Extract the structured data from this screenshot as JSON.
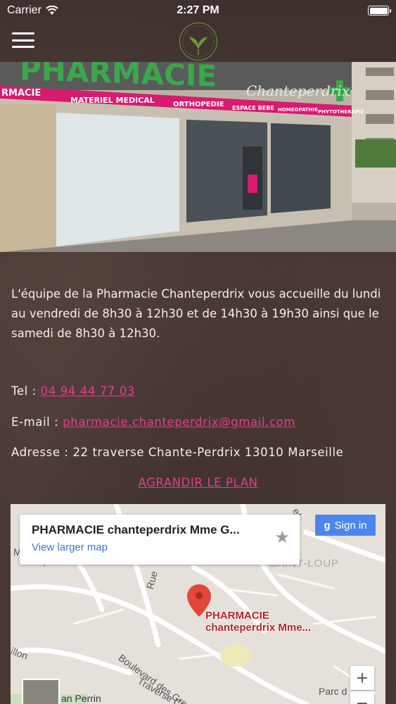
{
  "status_bar": {
    "carrier": "Carrier",
    "time": "2:27 PM"
  },
  "header": {
    "logo_text": "PHARMACIE Chanteperdrix"
  },
  "hero": {
    "sign_main": "PHARMACIE",
    "sign_script": "Chanteperdrix",
    "banner_items": [
      "RMACIE",
      "MATERIEL MEDICAL",
      "ORTHOPEDIE",
      "ESPACE BEBE",
      "HOMEOPATHIE",
      "PHYTOTHERAPIE"
    ],
    "brand_green": "#3aa84b",
    "brand_pink": "#d81b6e"
  },
  "intro": {
    "text": "L'équipe de la Pharmacie Chanteperdrix vous accueille du lundi au vendredi de 8h30 à 12h30 et  de 14h30 à 19h30 ainsi que le samedi de 8h30 à 12h30."
  },
  "contact": {
    "tel_label": "Tel : ",
    "tel_value": "04 94 44 77 03",
    "email_label": "E-mail : ",
    "email_value": "pharmacie.chanteperdrix@gmail.com",
    "address_label": "Adresse : ",
    "address_value": "22 traverse Chante-Perdrix 13010 Marseille",
    "link_color": "#e0408a"
  },
  "agrandir": {
    "label": "AGRANDIR LE PLAN"
  },
  "map": {
    "card_title": "PHARMACIE chanteperdrix Mme G...",
    "card_link": "View larger map",
    "signin_label": "Sign in",
    "pin_line1": "PHARMACIE",
    "pin_line2": "chanteperdrix Mme...",
    "labels": {
      "saint_loup": "SAINT-LOUP",
      "rue": "Rue",
      "boulevard": "Boulevard des Grands Pins",
      "traverse": "Traverse Ch",
      "villon": "illon",
      "perrin": "an Perrin",
      "parc": "Parc d",
      "st_loup": "St Loup",
      "m": "M",
      "el": "el"
    },
    "zoom_in": "+",
    "zoom_out": "−"
  }
}
